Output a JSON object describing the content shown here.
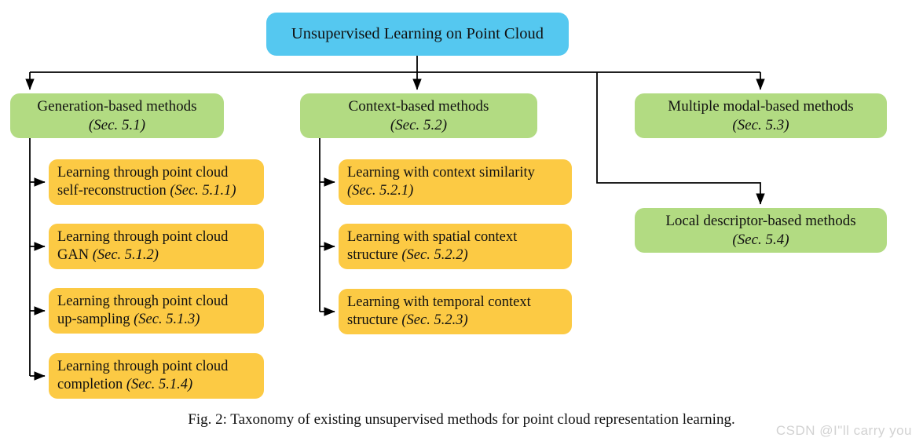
{
  "figure": {
    "caption": "Fig. 2: Taxonomy of existing unsupervised methods for point cloud representation learning.",
    "watermark": "CSDN @I\"ll  carry  you"
  },
  "colors": {
    "root_fill": "#55c8f0",
    "category_fill": "#b2db82",
    "leaf_fill": "#fcca44",
    "edge_stroke": "#000000",
    "text": "#111111",
    "watermark": "#d2d2d2"
  },
  "nodes": {
    "root": {
      "label": "Unsupervised Learning on Point Cloud"
    },
    "categories": [
      {
        "id": "generation-based",
        "title": "Generation-based methods",
        "section": "(Sec. 5.1)"
      },
      {
        "id": "context-based",
        "title": "Context-based methods",
        "section": "(Sec. 5.2)"
      },
      {
        "id": "multiple-modal-based",
        "title": "Multiple modal-based methods",
        "section": "(Sec. 5.3)"
      },
      {
        "id": "local-descriptor-based",
        "title": "Local descriptor-based methods",
        "section": "(Sec. 5.4)"
      }
    ],
    "generation_leaves": [
      {
        "id": "self-reconstruction",
        "line1": "Learning through point cloud",
        "line2_text": "self-reconstruction ",
        "line2_section": "(Sec. 5.1.1)"
      },
      {
        "id": "gan",
        "line1": "Learning through point cloud",
        "line2_text": "GAN ",
        "line2_section": "(Sec. 5.1.2)"
      },
      {
        "id": "up-sampling",
        "line1": "Learning through point cloud",
        "line2_text": "up-sampling ",
        "line2_section": "(Sec. 5.1.3)"
      },
      {
        "id": "completion",
        "line1": "Learning through point cloud",
        "line2_text": "completion ",
        "line2_section": "(Sec. 5.1.4)"
      }
    ],
    "context_leaves": [
      {
        "id": "context-similarity",
        "line1": "Learning with context similarity",
        "line2_text": "",
        "line2_section": "(Sec. 5.2.1)"
      },
      {
        "id": "spatial-context-structure",
        "line1": "Learning with spatial context",
        "line2_text": "structure ",
        "line2_section": "(Sec. 5.2.2)"
      },
      {
        "id": "temporal-context-structure",
        "line1": "Learning with temporal context",
        "line2_text": "structure ",
        "line2_section": "(Sec. 5.2.3)"
      }
    ]
  }
}
